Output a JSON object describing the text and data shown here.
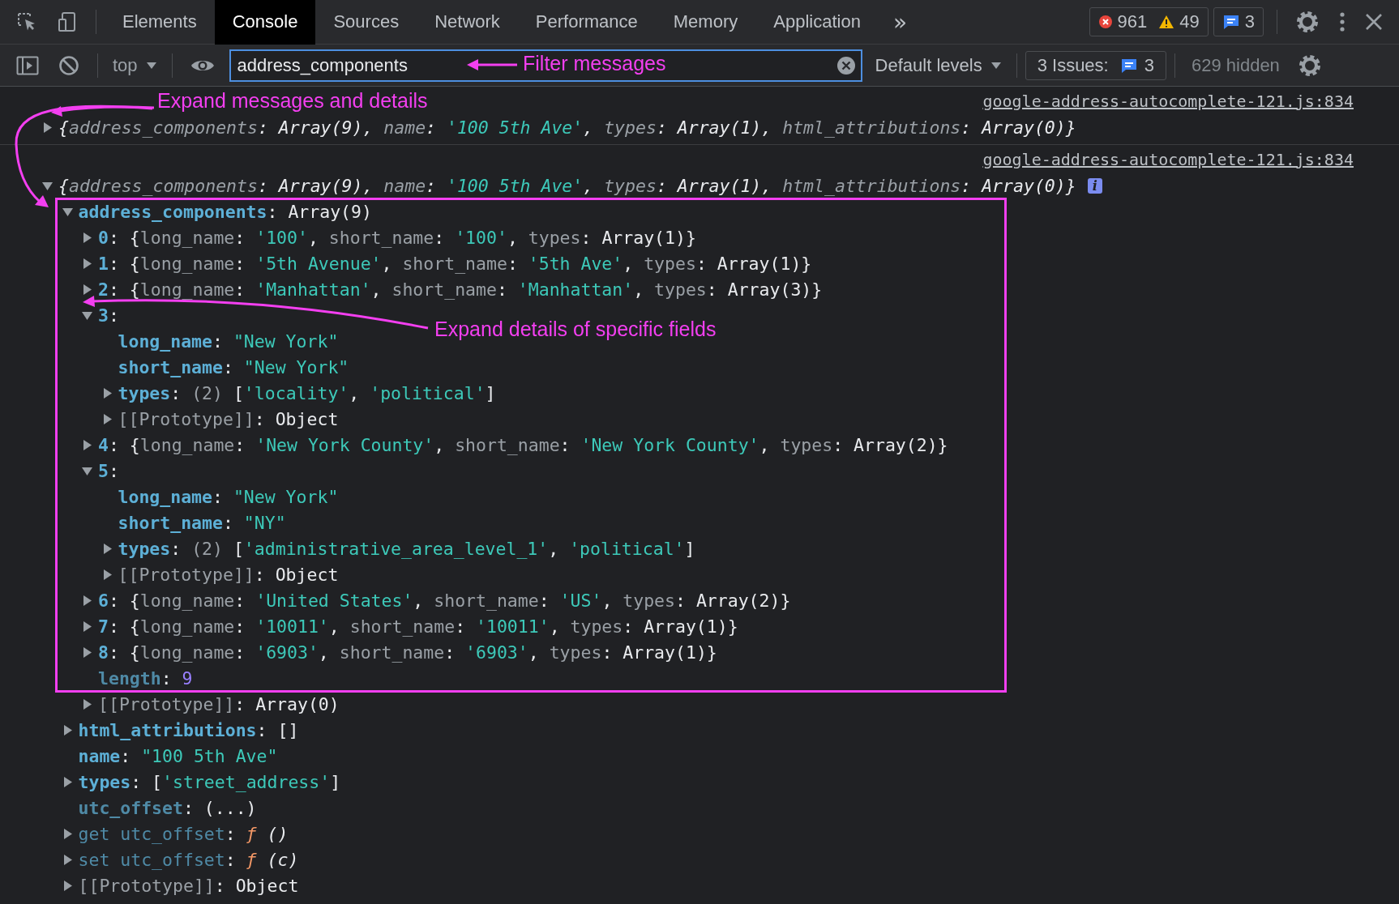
{
  "tabs": [
    {
      "label": "Elements",
      "selected": false
    },
    {
      "label": "Console",
      "selected": true
    },
    {
      "label": "Sources",
      "selected": false
    },
    {
      "label": "Network",
      "selected": false
    },
    {
      "label": "Performance",
      "selected": false
    },
    {
      "label": "Memory",
      "selected": false
    },
    {
      "label": "Application",
      "selected": false
    }
  ],
  "overflow": "»",
  "counts": {
    "errors": "961",
    "warnings": "49",
    "messages": "3"
  },
  "filter_bar": {
    "context": "top",
    "filter": {
      "value": "address_components"
    },
    "levels": "Default levels",
    "issues_label": "3 Issues:",
    "issues_count": "3",
    "hidden": "629 hidden"
  },
  "messages": [
    {
      "source": "google-address-autocomplete-121.js:834",
      "expanded": false,
      "summary": [
        {
          "kind": "plain",
          "text": "{"
        },
        {
          "kind": "pkey",
          "text": "address_components"
        },
        {
          "kind": "plain",
          "text": ": Array(9), "
        },
        {
          "kind": "pkey",
          "text": "name"
        },
        {
          "kind": "plain",
          "text": ": "
        },
        {
          "kind": "string",
          "text": "'100 5th Ave'"
        },
        {
          "kind": "plain",
          "text": ", "
        },
        {
          "kind": "pkey",
          "text": "types"
        },
        {
          "kind": "plain",
          "text": ": Array(1), "
        },
        {
          "kind": "pkey",
          "text": "html_attributions"
        },
        {
          "kind": "plain",
          "text": ": Array(0)}"
        }
      ]
    },
    {
      "source": "google-address-autocomplete-121.js:834",
      "expanded": true,
      "info_badge": "i",
      "summary": [
        {
          "kind": "plain",
          "text": "{"
        },
        {
          "kind": "pkey",
          "text": "address_components"
        },
        {
          "kind": "plain",
          "text": ": Array(9), "
        },
        {
          "kind": "pkey",
          "text": "name"
        },
        {
          "kind": "plain",
          "text": ": "
        },
        {
          "kind": "string",
          "text": "'100 5th Ave'"
        },
        {
          "kind": "plain",
          "text": ", "
        },
        {
          "kind": "pkey",
          "text": "types"
        },
        {
          "kind": "plain",
          "text": ": Array(1), "
        },
        {
          "kind": "pkey",
          "text": "html_attributions"
        },
        {
          "kind": "plain",
          "text": ": Array(0)}"
        }
      ],
      "children": [
        {
          "expanded": true,
          "segments": [
            {
              "kind": "key",
              "text": "address_components"
            },
            {
              "kind": "plain",
              "text": ": Array(9)"
            }
          ],
          "children": [
            {
              "expanded": false,
              "segments": [
                {
                  "kind": "key",
                  "text": "0"
                },
                {
                  "kind": "plain",
                  "text": ": {"
                },
                {
                  "kind": "pkey",
                  "text": "long_name"
                },
                {
                  "kind": "plain",
                  "text": ": "
                },
                {
                  "kind": "string",
                  "text": "'100'"
                },
                {
                  "kind": "plain",
                  "text": ", "
                },
                {
                  "kind": "pkey",
                  "text": "short_name"
                },
                {
                  "kind": "plain",
                  "text": ": "
                },
                {
                  "kind": "string",
                  "text": "'100'"
                },
                {
                  "kind": "plain",
                  "text": ", "
                },
                {
                  "kind": "pkey",
                  "text": "types"
                },
                {
                  "kind": "plain",
                  "text": ": Array(1)}"
                }
              ]
            },
            {
              "expanded": false,
              "segments": [
                {
                  "kind": "key",
                  "text": "1"
                },
                {
                  "kind": "plain",
                  "text": ": {"
                },
                {
                  "kind": "pkey",
                  "text": "long_name"
                },
                {
                  "kind": "plain",
                  "text": ": "
                },
                {
                  "kind": "string",
                  "text": "'5th Avenue'"
                },
                {
                  "kind": "plain",
                  "text": ", "
                },
                {
                  "kind": "pkey",
                  "text": "short_name"
                },
                {
                  "kind": "plain",
                  "text": ": "
                },
                {
                  "kind": "string",
                  "text": "'5th Ave'"
                },
                {
                  "kind": "plain",
                  "text": ", "
                },
                {
                  "kind": "pkey",
                  "text": "types"
                },
                {
                  "kind": "plain",
                  "text": ": Array(1)}"
                }
              ]
            },
            {
              "expanded": false,
              "segments": [
                {
                  "kind": "key",
                  "text": "2"
                },
                {
                  "kind": "plain",
                  "text": ": {"
                },
                {
                  "kind": "pkey",
                  "text": "long_name"
                },
                {
                  "kind": "plain",
                  "text": ": "
                },
                {
                  "kind": "string",
                  "text": "'Manhattan'"
                },
                {
                  "kind": "plain",
                  "text": ", "
                },
                {
                  "kind": "pkey",
                  "text": "short_name"
                },
                {
                  "kind": "plain",
                  "text": ": "
                },
                {
                  "kind": "string",
                  "text": "'Manhattan'"
                },
                {
                  "kind": "plain",
                  "text": ", "
                },
                {
                  "kind": "pkey",
                  "text": "types"
                },
                {
                  "kind": "plain",
                  "text": ": Array(3)}"
                }
              ]
            },
            {
              "expanded": true,
              "segments": [
                {
                  "kind": "key",
                  "text": "3"
                },
                {
                  "kind": "plain",
                  "text": ":"
                }
              ],
              "children": [
                {
                  "segments": [
                    {
                      "kind": "key",
                      "text": "long_name"
                    },
                    {
                      "kind": "plain",
                      "text": ": "
                    },
                    {
                      "kind": "string",
                      "text": "\"New York\""
                    }
                  ]
                },
                {
                  "segments": [
                    {
                      "kind": "key",
                      "text": "short_name"
                    },
                    {
                      "kind": "plain",
                      "text": ": "
                    },
                    {
                      "kind": "string",
                      "text": "\"New York\""
                    }
                  ]
                },
                {
                  "expanded": false,
                  "segments": [
                    {
                      "kind": "key",
                      "text": "types"
                    },
                    {
                      "kind": "plain",
                      "text": ": "
                    },
                    {
                      "kind": "proto",
                      "text": "(2)"
                    },
                    {
                      "kind": "plain",
                      "text": " ["
                    },
                    {
                      "kind": "string",
                      "text": "'locality'"
                    },
                    {
                      "kind": "plain",
                      "text": ", "
                    },
                    {
                      "kind": "string",
                      "text": "'political'"
                    },
                    {
                      "kind": "plain",
                      "text": "]"
                    }
                  ]
                },
                {
                  "expanded": false,
                  "segments": [
                    {
                      "kind": "proto",
                      "text": "[[Prototype]]"
                    },
                    {
                      "kind": "plain",
                      "text": ": Object"
                    }
                  ]
                }
              ]
            },
            {
              "expanded": false,
              "segments": [
                {
                  "kind": "key",
                  "text": "4"
                },
                {
                  "kind": "plain",
                  "text": ": {"
                },
                {
                  "kind": "pkey",
                  "text": "long_name"
                },
                {
                  "kind": "plain",
                  "text": ": "
                },
                {
                  "kind": "string",
                  "text": "'New York County'"
                },
                {
                  "kind": "plain",
                  "text": ", "
                },
                {
                  "kind": "pkey",
                  "text": "short_name"
                },
                {
                  "kind": "plain",
                  "text": ": "
                },
                {
                  "kind": "string",
                  "text": "'New York County'"
                },
                {
                  "kind": "plain",
                  "text": ", "
                },
                {
                  "kind": "pkey",
                  "text": "types"
                },
                {
                  "kind": "plain",
                  "text": ": Array(2)}"
                }
              ]
            },
            {
              "expanded": true,
              "segments": [
                {
                  "kind": "key",
                  "text": "5"
                },
                {
                  "kind": "plain",
                  "text": ":"
                }
              ],
              "children": [
                {
                  "segments": [
                    {
                      "kind": "key",
                      "text": "long_name"
                    },
                    {
                      "kind": "plain",
                      "text": ": "
                    },
                    {
                      "kind": "string",
                      "text": "\"New York\""
                    }
                  ]
                },
                {
                  "segments": [
                    {
                      "kind": "key",
                      "text": "short_name"
                    },
                    {
                      "kind": "plain",
                      "text": ": "
                    },
                    {
                      "kind": "string",
                      "text": "\"NY\""
                    }
                  ]
                },
                {
                  "expanded": false,
                  "segments": [
                    {
                      "kind": "key",
                      "text": "types"
                    },
                    {
                      "kind": "plain",
                      "text": ": "
                    },
                    {
                      "kind": "proto",
                      "text": "(2)"
                    },
                    {
                      "kind": "plain",
                      "text": " ["
                    },
                    {
                      "kind": "string",
                      "text": "'administrative_area_level_1'"
                    },
                    {
                      "kind": "plain",
                      "text": ", "
                    },
                    {
                      "kind": "string",
                      "text": "'political'"
                    },
                    {
                      "kind": "plain",
                      "text": "]"
                    }
                  ]
                },
                {
                  "expanded": false,
                  "segments": [
                    {
                      "kind": "proto",
                      "text": "[[Prototype]]"
                    },
                    {
                      "kind": "plain",
                      "text": ": Object"
                    }
                  ]
                }
              ]
            },
            {
              "expanded": false,
              "segments": [
                {
                  "kind": "key",
                  "text": "6"
                },
                {
                  "kind": "plain",
                  "text": ": {"
                },
                {
                  "kind": "pkey",
                  "text": "long_name"
                },
                {
                  "kind": "plain",
                  "text": ": "
                },
                {
                  "kind": "string",
                  "text": "'United States'"
                },
                {
                  "kind": "plain",
                  "text": ", "
                },
                {
                  "kind": "pkey",
                  "text": "short_name"
                },
                {
                  "kind": "plain",
                  "text": ": "
                },
                {
                  "kind": "string",
                  "text": "'US'"
                },
                {
                  "kind": "plain",
                  "text": ", "
                },
                {
                  "kind": "pkey",
                  "text": "types"
                },
                {
                  "kind": "plain",
                  "text": ": Array(2)}"
                }
              ]
            },
            {
              "expanded": false,
              "segments": [
                {
                  "kind": "key",
                  "text": "7"
                },
                {
                  "kind": "plain",
                  "text": ": {"
                },
                {
                  "kind": "pkey",
                  "text": "long_name"
                },
                {
                  "kind": "plain",
                  "text": ": "
                },
                {
                  "kind": "string",
                  "text": "'10011'"
                },
                {
                  "kind": "plain",
                  "text": ", "
                },
                {
                  "kind": "pkey",
                  "text": "short_name"
                },
                {
                  "kind": "plain",
                  "text": ": "
                },
                {
                  "kind": "string",
                  "text": "'10011'"
                },
                {
                  "kind": "plain",
                  "text": ", "
                },
                {
                  "kind": "pkey",
                  "text": "types"
                },
                {
                  "kind": "plain",
                  "text": ": Array(1)}"
                }
              ]
            },
            {
              "expanded": false,
              "segments": [
                {
                  "kind": "key",
                  "text": "8"
                },
                {
                  "kind": "plain",
                  "text": ": {"
                },
                {
                  "kind": "pkey",
                  "text": "long_name"
                },
                {
                  "kind": "plain",
                  "text": ": "
                },
                {
                  "kind": "string",
                  "text": "'6903'"
                },
                {
                  "kind": "plain",
                  "text": ", "
                },
                {
                  "kind": "pkey",
                  "text": "short_name"
                },
                {
                  "kind": "plain",
                  "text": ": "
                },
                {
                  "kind": "string",
                  "text": "'6903'"
                },
                {
                  "kind": "plain",
                  "text": ", "
                },
                {
                  "kind": "pkey",
                  "text": "types"
                },
                {
                  "kind": "plain",
                  "text": ": Array(1)}"
                }
              ]
            },
            {
              "segments": [
                {
                  "kind": "dkey",
                  "text": "length"
                },
                {
                  "kind": "plain",
                  "text": ": "
                },
                {
                  "kind": "number",
                  "text": "9"
                }
              ]
            },
            {
              "expanded": false,
              "segments": [
                {
                  "kind": "proto",
                  "text": "[[Prototype]]"
                },
                {
                  "kind": "plain",
                  "text": ": Array(0)"
                }
              ]
            }
          ]
        },
        {
          "expanded": false,
          "segments": [
            {
              "kind": "key",
              "text": "html_attributions"
            },
            {
              "kind": "plain",
              "text": ": []"
            }
          ]
        },
        {
          "segments": [
            {
              "kind": "key",
              "text": "name"
            },
            {
              "kind": "plain",
              "text": ": "
            },
            {
              "kind": "string",
              "text": "\"100 5th Ave\""
            }
          ]
        },
        {
          "expanded": false,
          "segments": [
            {
              "kind": "key",
              "text": "types"
            },
            {
              "kind": "plain",
              "text": ": ["
            },
            {
              "kind": "string",
              "text": "'street_address'"
            },
            {
              "kind": "plain",
              "text": "]"
            }
          ]
        },
        {
          "segments": [
            {
              "kind": "dkey",
              "text": "utc_offset"
            },
            {
              "kind": "plain",
              "text": ": (...)"
            }
          ]
        },
        {
          "expanded": false,
          "segments": [
            {
              "kind": "accessor",
              "text": "get utc_offset"
            },
            {
              "kind": "plain",
              "text": ": "
            },
            {
              "kind": "func",
              "text": "ƒ"
            },
            {
              "kind": "italic",
              "text": " ()"
            }
          ]
        },
        {
          "expanded": false,
          "segments": [
            {
              "kind": "accessor",
              "text": "set utc_offset"
            },
            {
              "kind": "plain",
              "text": ": "
            },
            {
              "kind": "func",
              "text": "ƒ"
            },
            {
              "kind": "italic",
              "text": " (c)"
            }
          ]
        },
        {
          "expanded": false,
          "segments": [
            {
              "kind": "proto",
              "text": "[[Prototype]]"
            },
            {
              "kind": "plain",
              "text": ": Object"
            }
          ]
        }
      ]
    }
  ],
  "annotations": [
    {
      "text": "Filter messages"
    },
    {
      "text": "Expand messages and details"
    },
    {
      "text": "Expand details of specific fields"
    }
  ]
}
